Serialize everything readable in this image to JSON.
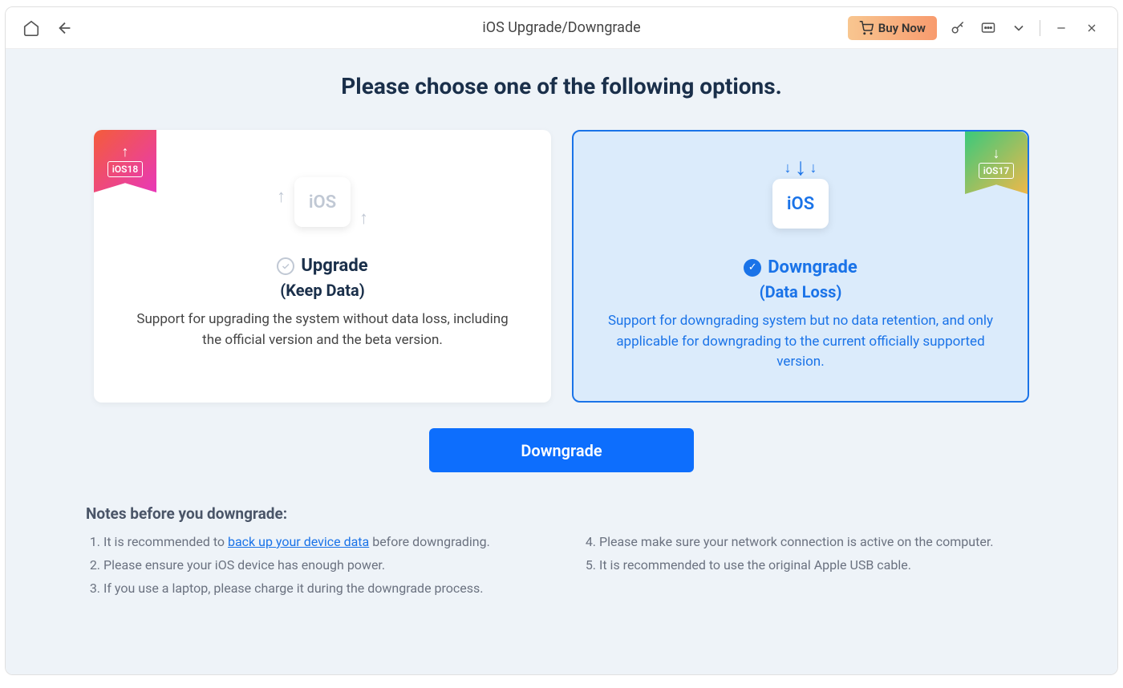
{
  "titlebar": {
    "title": "iOS Upgrade/Downgrade",
    "buy_label": "Buy Now"
  },
  "heading": "Please choose one of the following options.",
  "cards": {
    "upgrade": {
      "ribbon_version": "iOS18",
      "ios_label": "iOS",
      "title": "Upgrade",
      "subtitle": "(Keep Data)",
      "description": "Support for upgrading the system without data loss, including the official version and the beta version.",
      "selected": false
    },
    "downgrade": {
      "ribbon_version": "iOS17",
      "ios_label": "iOS",
      "title": "Downgrade",
      "subtitle": "(Data Loss)",
      "description": "Support for downgrading system but no data retention, and only applicable for downgrading to the current officially supported version.",
      "selected": true
    }
  },
  "primary_button": "Downgrade",
  "notes": {
    "heading": "Notes before you downgrade:",
    "col1": [
      {
        "prefix": "It is recommended to ",
        "link": "back up your device data",
        "suffix": " before downgrading."
      },
      {
        "text": "Please ensure your iOS device has enough power."
      },
      {
        "text": "If you use a laptop, please charge it during the downgrade process."
      }
    ],
    "col2": [
      {
        "text": "Please make sure your network connection is active on the computer."
      },
      {
        "text": "It is recommended to use the original Apple USB cable."
      }
    ]
  }
}
